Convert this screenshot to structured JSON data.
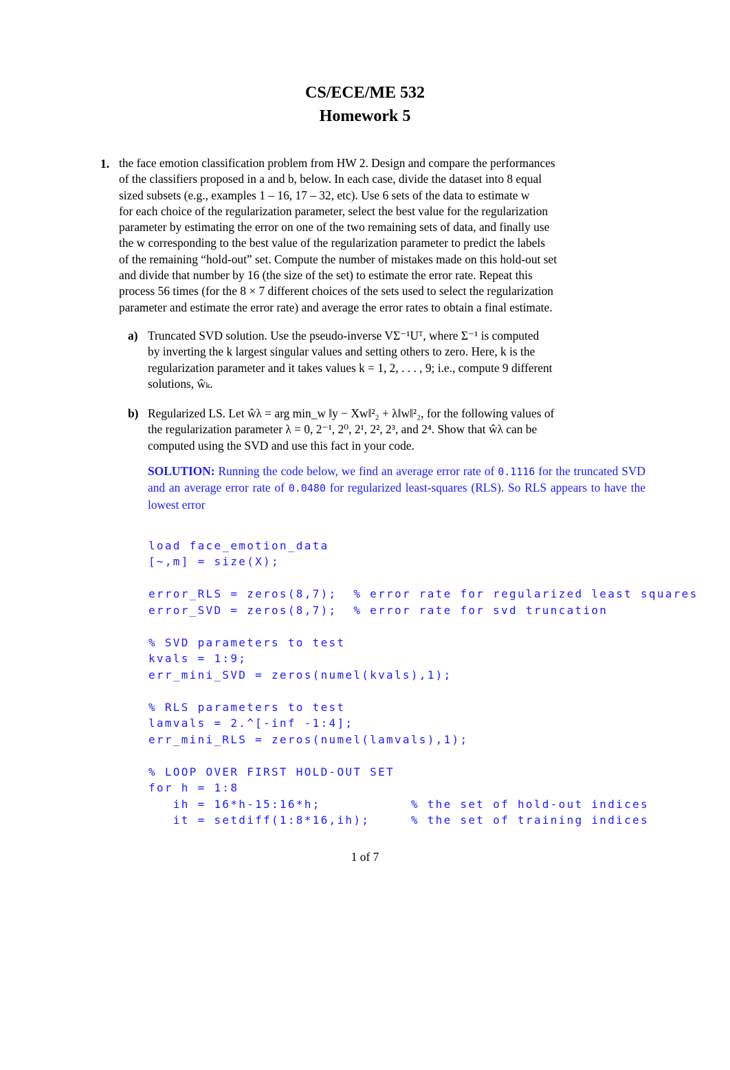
{
  "header": {
    "course": "CS/ECE/ME 532",
    "assignment": "Homework 5"
  },
  "problem": {
    "number": "1.",
    "intro_lines": [
      "the face emotion classification problem from HW 2. Design and compare the performances",
      "of the classifiers proposed in a and b, below. In each case, divide the dataset into 8 equal",
      "sized subsets (e.g., examples 1 – 16, 17 – 32, etc).  Use 6 sets of the data to estimate w",
      "for each choice of the regularization parameter, select the best value for the regularization",
      "parameter by estimating the error on one of the two remaining sets of data, and finally use",
      "the w corresponding to the best value of the regularization parameter to predict the labels",
      "of the remaining “hold-out” set. Compute the number of mistakes made on this hold-out set",
      "and divide that number by 16 (the size of the set) to estimate the error rate. Repeat this",
      "process 56 times (for the 8 × 7 different choices of the sets used to select the regularization",
      "parameter and estimate the error rate) and average the error rates to obtain a final estimate."
    ],
    "parts": [
      {
        "label": "a)",
        "lines": [
          "Truncated SVD solution.  Use the pseudo-inverse VΣ⁻¹Uᵀ, where Σ⁻¹ is computed",
          "by inverting the k largest singular values and setting others to zero.  Here, k is the",
          "regularization parameter and it takes values k = 1, 2, . . . , 9; i.e., compute 9 different",
          "solutions, ŵₖ."
        ]
      },
      {
        "label": "b)",
        "lines": [
          "Regularized LS. Let ŵλ = arg min_w ‖y − Xw‖²₂ + λ‖w‖²₂, for the following values of",
          "the regularization parameter λ = 0, 2⁻¹, 2⁰, 2¹, 2², 2³, and 2⁴.  Show that ŵλ can be",
          "computed using the SVD and use this fact in your code."
        ]
      }
    ]
  },
  "solution": {
    "heading": "SOLUTION:",
    "text_1": "Running the code below, we find an average error rate of",
    "svd_error": "0.1116",
    "text_2": "for the truncated SVD and an average error rate of",
    "rls_error": "0.0480",
    "text_3": "for regularized least-squares (RLS). So RLS appears to have the lowest error",
    "accent_color": "#1a1aff"
  },
  "code_lines": [
    "load face_emotion_data",
    "[~,m] = size(X);",
    "",
    "error_RLS = zeros(8,7);  % error rate for regularized least squares",
    "error_SVD = zeros(8,7);  % error rate for svd truncation",
    "",
    "% SVD parameters to test",
    "kvals = 1:9;",
    "err_mini_SVD = zeros(numel(kvals),1);",
    "",
    "% RLS parameters to test",
    "lamvals = 2.^[-inf -1:4];",
    "err_mini_RLS = zeros(numel(lamvals),1);",
    "",
    "% LOOP OVER FIRST HOLD-OUT SET",
    "for h = 1:8",
    "   ih = 16*h-15:16*h;           % the set of hold-out indices",
    "   it = setdiff(1:8*16,ih);     % the set of training indices"
  ],
  "footer": {
    "page_indicator": "1 of 7"
  }
}
